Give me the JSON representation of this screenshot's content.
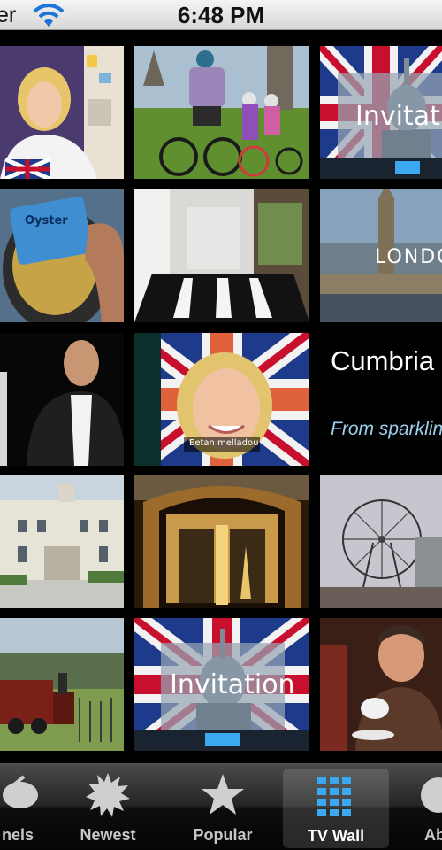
{
  "status_bar": {
    "carrier": "er",
    "time": "6:48 PM"
  },
  "tiles": {
    "invitation_text": "Invitation",
    "london_text": "LONDON",
    "cumbria_title": "Cumbria",
    "cumbria_subtitle": "From sparkling",
    "caption_text": "Eetan melladou"
  },
  "tab_bar": {
    "items": [
      {
        "label": "nels",
        "icon": "channels-icon"
      },
      {
        "label": "Newest",
        "icon": "newest-icon"
      },
      {
        "label": "Popular",
        "icon": "star-icon"
      },
      {
        "label": "TV Wall",
        "icon": "grid-icon",
        "active": true
      },
      {
        "label": "Ab",
        "icon": "about-icon"
      }
    ]
  },
  "colors": {
    "subtitle_blue": "#9fd1ef",
    "accent_blue": "#3aa9f2",
    "status_bar": "#e6e6e6"
  }
}
